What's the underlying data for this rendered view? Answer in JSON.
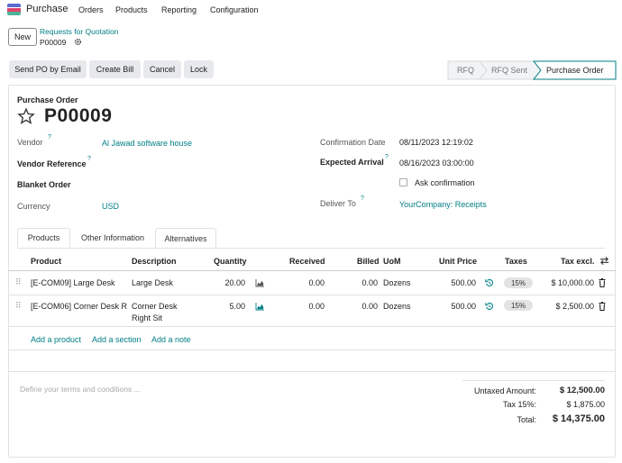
{
  "navbar": {
    "app_name": "Purchase",
    "menu": [
      "Orders",
      "Products",
      "Reporting",
      "Configuration"
    ]
  },
  "control": {
    "new_label": "New",
    "breadcrumb_parent": "Requests for Quotation",
    "record_name": "P00009"
  },
  "actions": {
    "send_po": "Send PO by Email",
    "create_bill": "Create Bill",
    "cancel": "Cancel",
    "lock": "Lock"
  },
  "statusbar": {
    "steps": [
      "RFQ",
      "RFQ Sent",
      "Purchase Order"
    ],
    "active": "Purchase Order"
  },
  "form": {
    "doc_type": "Purchase Order",
    "name": "P00009",
    "vendor_label": "Vendor",
    "vendor_value": "Al Jawad software house",
    "vendor_ref_label": "Vendor Reference",
    "blanket_label": "Blanket Order",
    "currency_label": "Currency",
    "currency_value": "USD",
    "confirmation_label": "Confirmation Date",
    "confirmation_value": "08/11/2023 12:19:02",
    "expected_label": "Expected Arrival",
    "expected_value": "08/16/2023 03:00:00",
    "ask_confirmation": "Ask confirmation",
    "deliver_label": "Deliver To",
    "deliver_value": "YourCompany: Receipts",
    "help_mark": "?"
  },
  "tabs": [
    "Products",
    "Other Information",
    "Alternatives"
  ],
  "table": {
    "headers": {
      "product": "Product",
      "description": "Description",
      "quantity": "Quantity",
      "received": "Received",
      "billed": "Billed",
      "uom": "UoM",
      "unit_price": "Unit Price",
      "taxes": "Taxes",
      "tax_excl": "Tax excl."
    },
    "rows": [
      {
        "product": "[E-COM09] Large Desk",
        "description": "Large Desk",
        "description2": "",
        "quantity": "20.00",
        "received": "0.00",
        "billed": "0.00",
        "uom": "Dozens",
        "unit_price": "500.00",
        "tax": "15%",
        "subtotal": "$ 10,000.00"
      },
      {
        "product": "[E-COM06] Corner Desk R",
        "description": "Corner Desk",
        "description2": "Right Sit",
        "quantity": "5.00",
        "received": "0.00",
        "billed": "0.00",
        "uom": "Dozens",
        "unit_price": "500.00",
        "tax": "15%",
        "subtotal": "$ 2,500.00"
      }
    ],
    "add_product": "Add a product",
    "add_section": "Add a section",
    "add_note": "Add a note"
  },
  "terms_placeholder": "Define your terms and conditions ...",
  "totals": {
    "untaxed_label": "Untaxed Amount:",
    "untaxed_value": "$ 12,500.00",
    "tax_label": "Tax 15%:",
    "tax_value": "$ 1,875.00",
    "total_label": "Total:",
    "total_value": "$ 14,375.00"
  },
  "colors": {
    "accent": "#017e84",
    "brand": "#714b67"
  }
}
